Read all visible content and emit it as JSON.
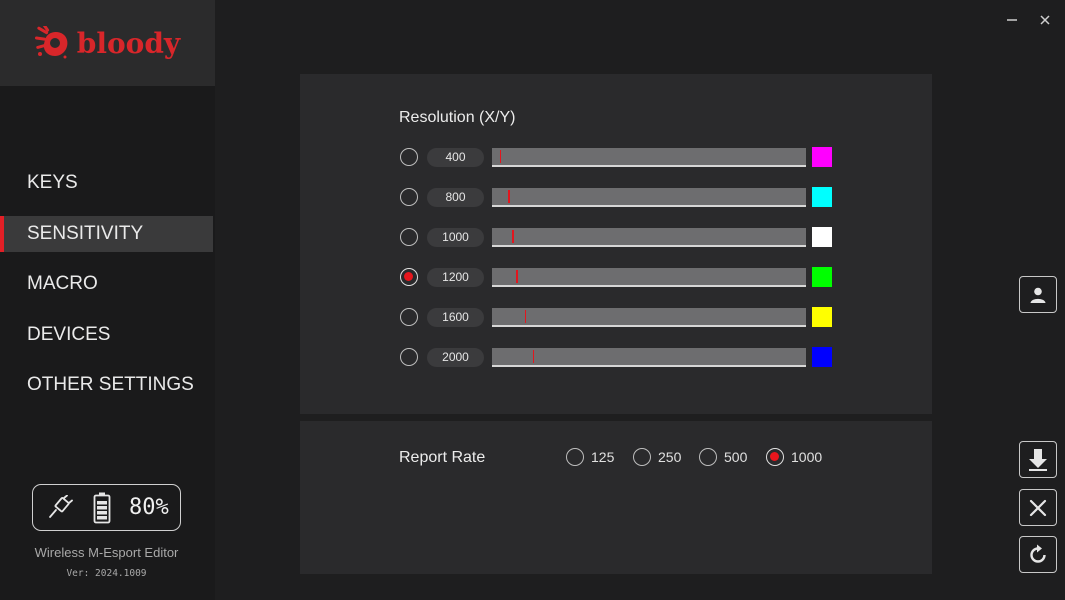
{
  "app": {
    "logo_text": "bloody",
    "name": "Wireless M-Esport Editor",
    "version": "Ver: 2024.1009"
  },
  "window": {
    "minimize_label": "—",
    "close_label": "✕"
  },
  "sidebar": {
    "items": [
      {
        "label": "KEYS",
        "active": false
      },
      {
        "label": "SENSITIVITY",
        "active": true
      },
      {
        "label": "MACRO",
        "active": false
      },
      {
        "label": "DEVICES",
        "active": false
      },
      {
        "label": "OTHER SETTINGS",
        "active": false
      }
    ],
    "battery": {
      "icons": [
        "wired-plug-icon",
        "battery-icon"
      ],
      "percent": "80%"
    }
  },
  "resolution": {
    "title": "Resolution (X/Y)",
    "rows": [
      {
        "dpi": "400",
        "slider_fraction": 0.025,
        "color": "#ff00ff",
        "selected": false
      },
      {
        "dpi": "800",
        "slider_fraction": 0.052,
        "color": "#00ffff",
        "selected": false
      },
      {
        "dpi": "1000",
        "slider_fraction": 0.065,
        "color": "#ffffff",
        "selected": false
      },
      {
        "dpi": "1200",
        "slider_fraction": 0.078,
        "color": "#00ff00",
        "selected": true
      },
      {
        "dpi": "1600",
        "slider_fraction": 0.104,
        "color": "#ffff00",
        "selected": false
      },
      {
        "dpi": "2000",
        "slider_fraction": 0.13,
        "color": "#0000ff",
        "selected": false
      }
    ]
  },
  "report_rate": {
    "label": "Report Rate",
    "options": [
      {
        "value": "125",
        "selected": false
      },
      {
        "value": "250",
        "selected": false
      },
      {
        "value": "500",
        "selected": false
      },
      {
        "value": "1000",
        "selected": true
      }
    ]
  },
  "side_buttons": [
    "profile-icon",
    "download-icon",
    "close-icon",
    "refresh-icon"
  ],
  "colors": {
    "accent": "#e21f26",
    "background": "#1e1e1f",
    "panel": "#2a2a2c"
  }
}
